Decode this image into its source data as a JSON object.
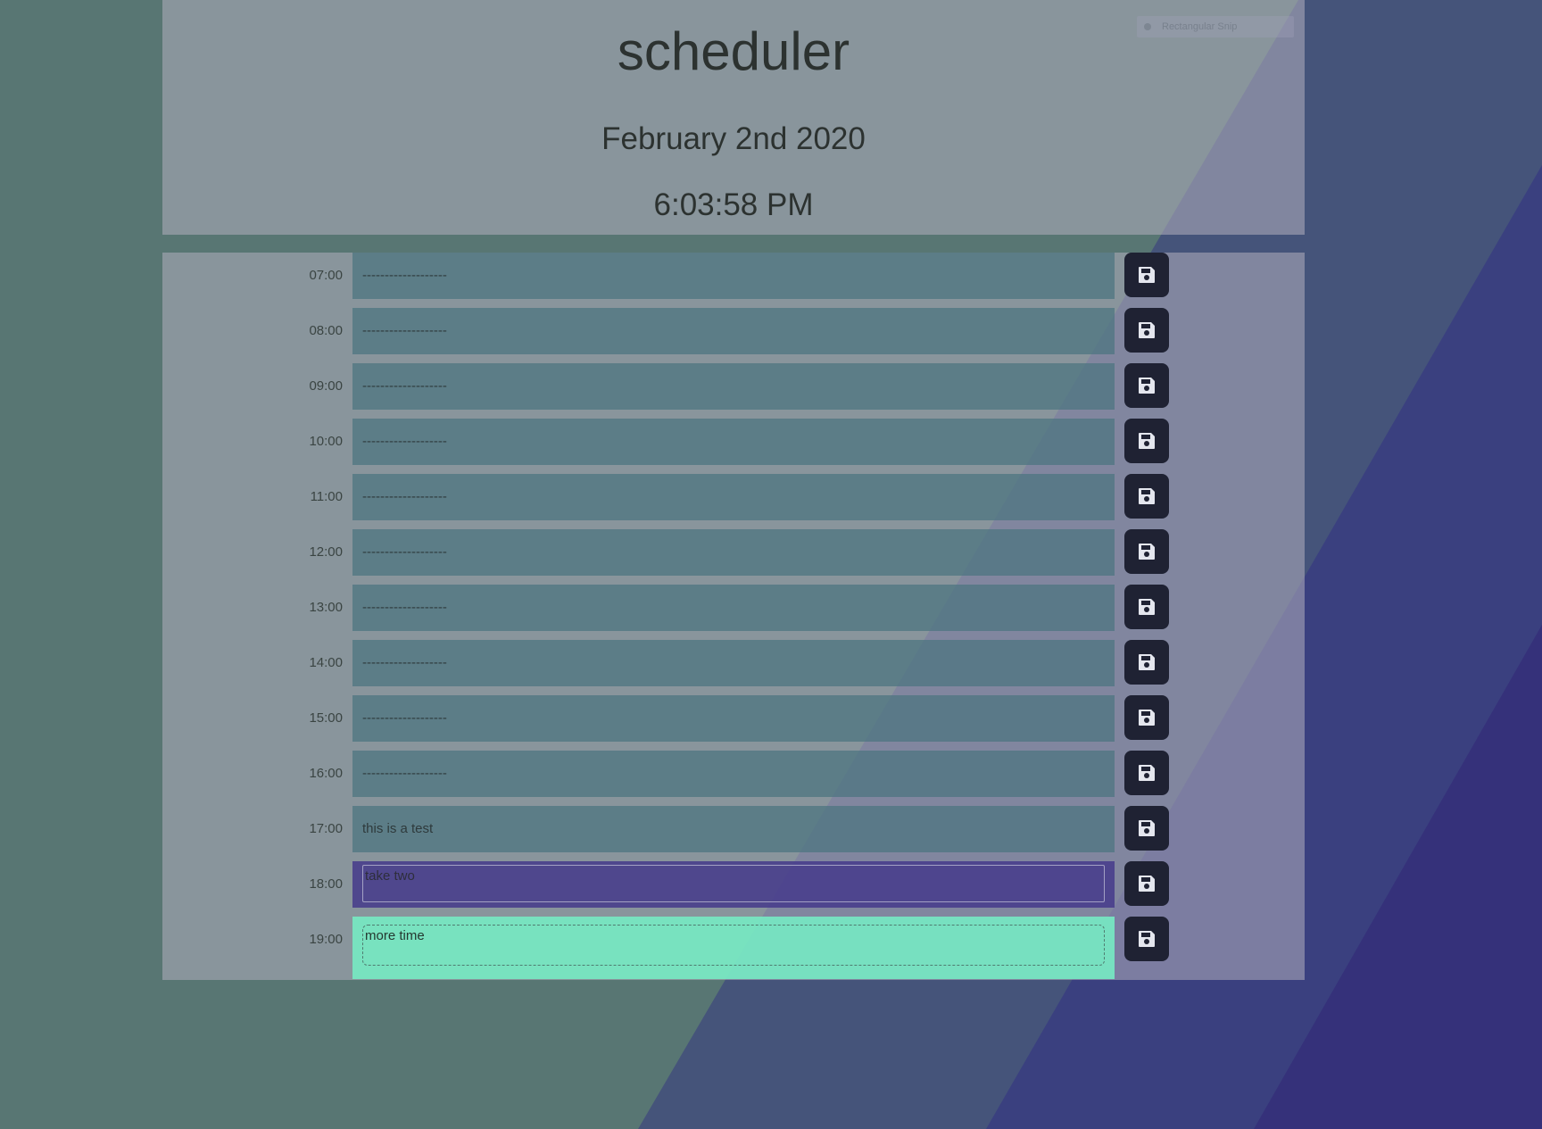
{
  "header": {
    "title": "scheduler",
    "date": "February 2nd 2020",
    "time": "6:03:58 PM"
  },
  "overlay": {
    "snip_label": "Rectangular Snip"
  },
  "icons": {
    "save": "floppy-disk-icon"
  },
  "colors": {
    "past": "#507682",
    "present": "#4a408c",
    "future": "#76e8c2",
    "save_button": "#1f2233"
  },
  "rows": [
    {
      "hour": "07:00",
      "text": "-------------------",
      "state": "past"
    },
    {
      "hour": "08:00",
      "text": "-------------------",
      "state": "past"
    },
    {
      "hour": "09:00",
      "text": "-------------------",
      "state": "past"
    },
    {
      "hour": "10:00",
      "text": "-------------------",
      "state": "past"
    },
    {
      "hour": "11:00",
      "text": "-------------------",
      "state": "past"
    },
    {
      "hour": "12:00",
      "text": "-------------------",
      "state": "past"
    },
    {
      "hour": "13:00",
      "text": "-------------------",
      "state": "past"
    },
    {
      "hour": "14:00",
      "text": "-------------------",
      "state": "past"
    },
    {
      "hour": "15:00",
      "text": "-------------------",
      "state": "past"
    },
    {
      "hour": "16:00",
      "text": "-------------------",
      "state": "past"
    },
    {
      "hour": "17:00",
      "text": "this is a test",
      "state": "past"
    },
    {
      "hour": "18:00",
      "text": "take two",
      "state": "present"
    },
    {
      "hour": "19:00",
      "text": "more time",
      "state": "future"
    }
  ]
}
